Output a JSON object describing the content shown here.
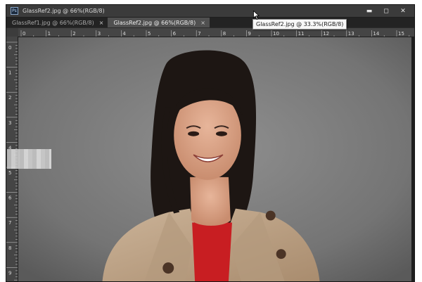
{
  "window": {
    "title": "GlassRef2.jpg @ 66%(RGB/8)",
    "app_icon_label": "Ps",
    "controls": {
      "minimize": "▬",
      "maximize": "◻",
      "close": "✕"
    }
  },
  "tabs": [
    {
      "label": "GlassRef1.jpg @ 66%(RGB/8)",
      "close": "×",
      "active": false
    },
    {
      "label": "GlassRef2.jpg @ 66%(RGB/8)",
      "close": "×",
      "active": true
    }
  ],
  "tooltip": {
    "text": "GlassRef2.jpg @ 33.3%(RGB/8)"
  },
  "rulers": {
    "horizontal_labels": [
      "0",
      "1",
      "2",
      "3",
      "4",
      "5",
      "6",
      "7",
      "8",
      "9",
      "10",
      "11",
      "12",
      "13",
      "14",
      "15"
    ],
    "vertical_labels": [
      "0",
      "1",
      "2",
      "3",
      "4",
      "5",
      "6",
      "7",
      "8",
      "9"
    ]
  },
  "document": {
    "zoom": "66%",
    "color_mode": "RGB/8",
    "image_subject": "portrait of smiling woman in beige trench coat and red top"
  },
  "colors": {
    "window_bg": "#2a2a2a",
    "titlebar": "#3b3b3b",
    "active_tab": "#505050",
    "ruler": "#454545",
    "backdrop": "#6b6b6b"
  }
}
